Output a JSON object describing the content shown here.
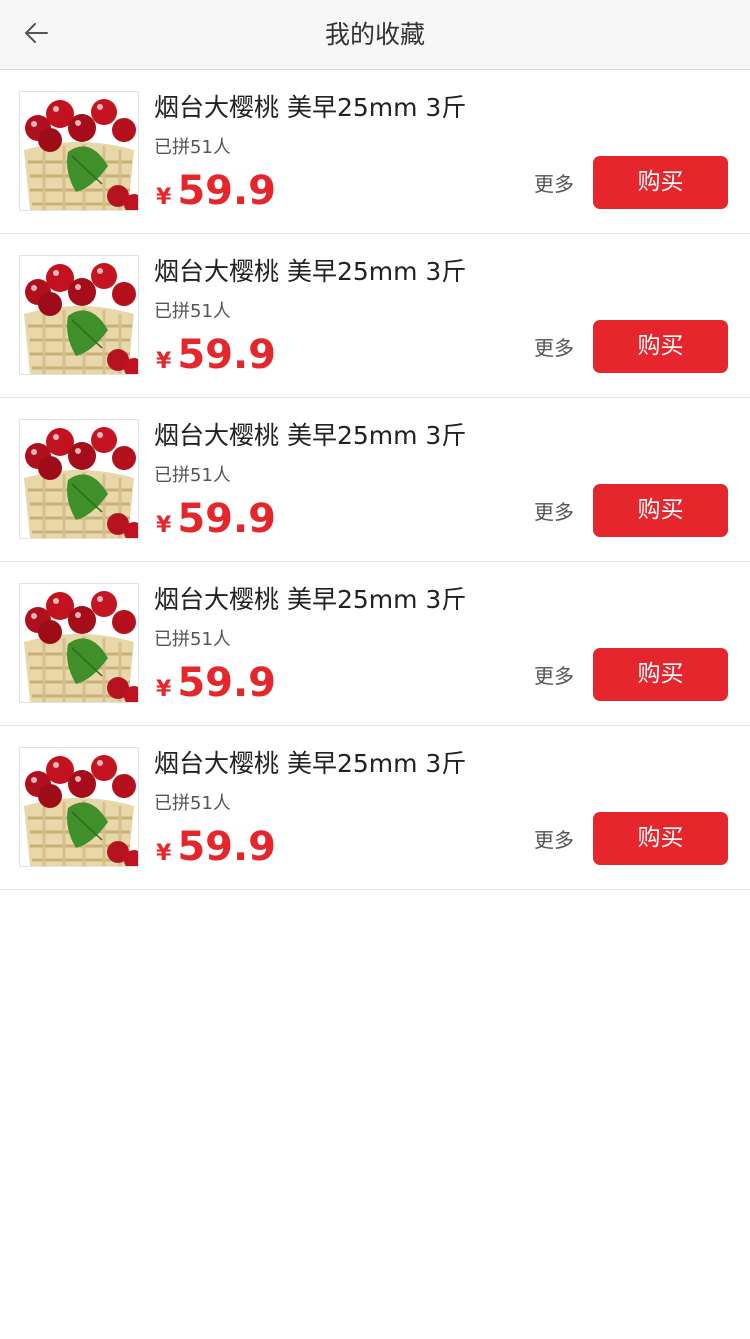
{
  "header": {
    "title": "我的收藏",
    "back_icon": "arrow-left-icon"
  },
  "colors": {
    "accent": "#e5262b",
    "button_bg": "#e5272d",
    "header_bg": "#f7f7f7"
  },
  "items": [
    {
      "name": "烟台大樱桃 美早25mm 3斤",
      "joined": "已拼51人",
      "currency": "¥",
      "price": "59.9",
      "more_label": "更多",
      "buy_label": "购买",
      "image": "cherry-basket-image"
    },
    {
      "name": "烟台大樱桃 美早25mm 3斤",
      "joined": "已拼51人",
      "currency": "¥",
      "price": "59.9",
      "more_label": "更多",
      "buy_label": "购买",
      "image": "cherry-basket-image"
    },
    {
      "name": "烟台大樱桃 美早25mm 3斤",
      "joined": "已拼51人",
      "currency": "¥",
      "price": "59.9",
      "more_label": "更多",
      "buy_label": "购买",
      "image": "cherry-basket-image"
    },
    {
      "name": "烟台大樱桃 美早25mm 3斤",
      "joined": "已拼51人",
      "currency": "¥",
      "price": "59.9",
      "more_label": "更多",
      "buy_label": "购买",
      "image": "cherry-basket-image"
    },
    {
      "name": "烟台大樱桃 美早25mm 3斤",
      "joined": "已拼51人",
      "currency": "¥",
      "price": "59.9",
      "more_label": "更多",
      "buy_label": "购买",
      "image": "cherry-basket-image"
    }
  ]
}
